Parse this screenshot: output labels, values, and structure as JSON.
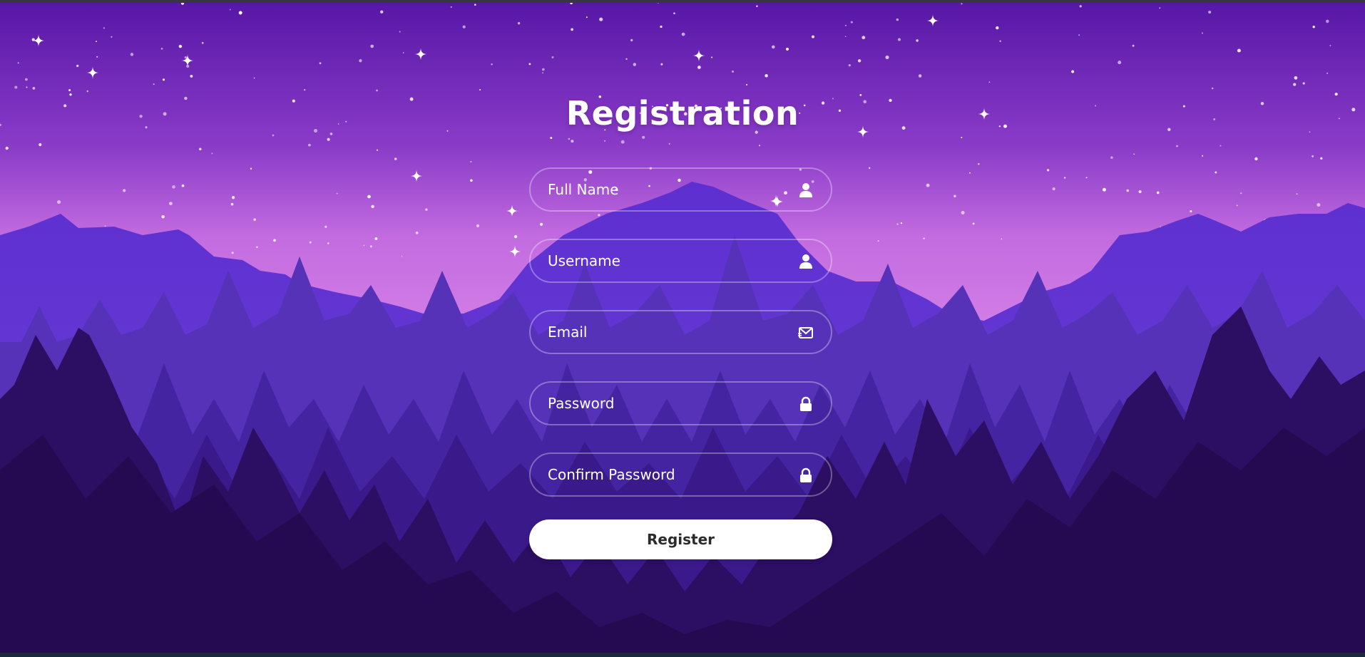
{
  "page": {
    "title": "Registration"
  },
  "form": {
    "fields": [
      {
        "placeholder": "Full Name",
        "value": "",
        "icon": "user-icon"
      },
      {
        "placeholder": "Username",
        "value": "",
        "icon": "user-icon"
      },
      {
        "placeholder": "Email",
        "value": "",
        "icon": "envelope-icon"
      },
      {
        "placeholder": "Password",
        "value": "",
        "icon": "lock-icon"
      },
      {
        "placeholder": "Confirm Password",
        "value": "",
        "icon": "lock-icon"
      }
    ],
    "submit_label": "Register"
  },
  "colors": {
    "sky_top": "#5a1aa8",
    "sky_horizon": "#c56ee0",
    "mountain": "#6a3ad0",
    "forest_back": "#5430b8",
    "forest_mid": "#3f1f94",
    "forest_front": "#2b0d5e",
    "button_bg": "#ffffff",
    "text": "#ffffff"
  }
}
